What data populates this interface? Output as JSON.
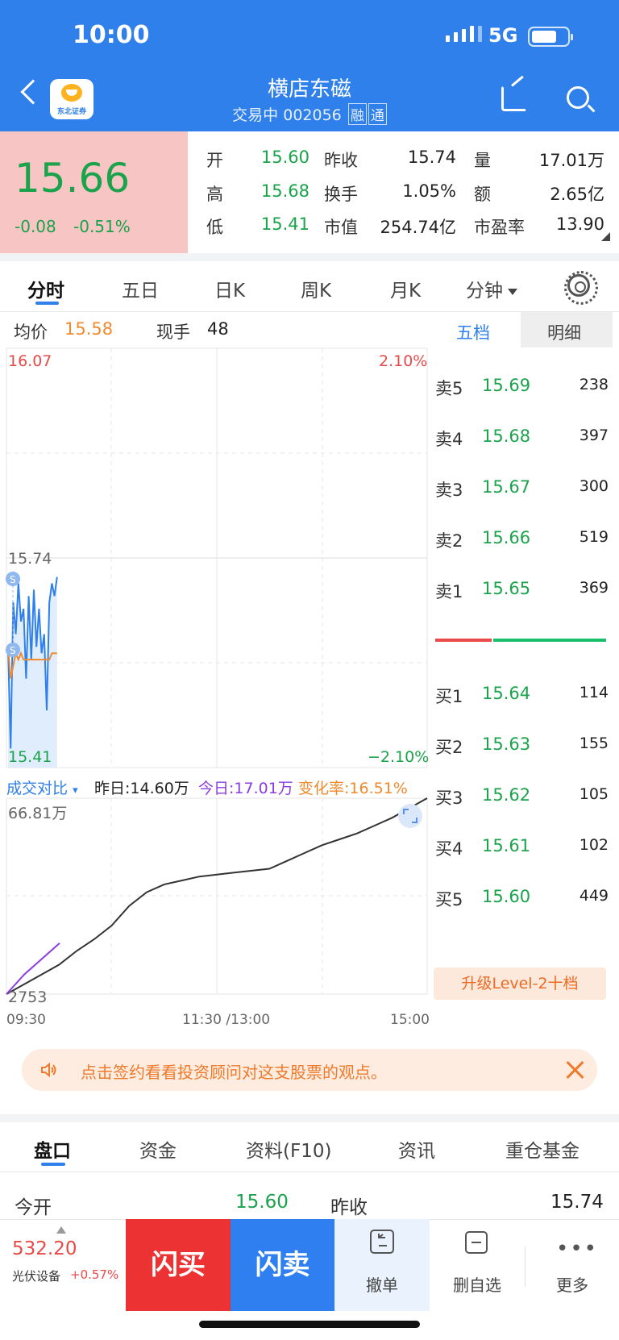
{
  "status_bar": {
    "time": "10:00",
    "network": "5G"
  },
  "header": {
    "broker": "东北证券",
    "stock_name": "横店东磁",
    "status": "交易中",
    "code": "002056",
    "tags": [
      "融",
      "通"
    ]
  },
  "quote": {
    "price": "15.66",
    "change": "-0.08",
    "change_pct": "-0.51%",
    "fields": [
      {
        "label": "开",
        "value": "15.60"
      },
      {
        "label": "昨收",
        "value": "15.74"
      },
      {
        "label": "量",
        "value": "17.01万"
      },
      {
        "label": "高",
        "value": "15.68"
      },
      {
        "label": "换手",
        "value": "1.05%"
      },
      {
        "label": "额",
        "value": "2.65亿"
      },
      {
        "label": "低",
        "value": "15.41"
      },
      {
        "label": "市值",
        "value": "254.74亿"
      },
      {
        "label": "市盈率",
        "value": "13.90"
      }
    ]
  },
  "chart_tabs": [
    "分时",
    "五日",
    "日K",
    "周K",
    "月K",
    "分钟"
  ],
  "chart_header": {
    "avg_label": "均价",
    "avg_value": "15.58",
    "cur_label": "现手",
    "cur_value": "48"
  },
  "orderbook_tabs": [
    "五档",
    "明细"
  ],
  "orderbook": {
    "sell": [
      {
        "label": "卖5",
        "price": "15.69",
        "vol": "238"
      },
      {
        "label": "卖4",
        "price": "15.68",
        "vol": "397"
      },
      {
        "label": "卖3",
        "price": "15.67",
        "vol": "300"
      },
      {
        "label": "卖2",
        "price": "15.66",
        "vol": "519"
      },
      {
        "label": "卖1",
        "price": "15.65",
        "vol": "369"
      }
    ],
    "buy": [
      {
        "label": "买1",
        "price": "15.64",
        "vol": "114"
      },
      {
        "label": "买2",
        "price": "15.63",
        "vol": "155"
      },
      {
        "label": "买3",
        "price": "15.62",
        "vol": "105"
      },
      {
        "label": "买4",
        "price": "15.61",
        "vol": "102"
      },
      {
        "label": "买5",
        "price": "15.60",
        "vol": "449"
      }
    ],
    "upgrade": "升级Level-2十档"
  },
  "chart_data": [
    {
      "type": "line",
      "y_top_label": "16.07",
      "y_mid_label": "15.74",
      "y_bottom_label": "15.41",
      "pct_top_label": "2.10%",
      "pct_bottom_label": "−2.10%",
      "ylim": [
        15.41,
        16.07
      ],
      "series": [
        {
          "values": [
            15.6,
            15.44,
            15.67,
            15.62,
            15.7,
            15.64,
            15.66,
            15.55,
            15.68,
            15.58,
            15.69,
            15.6,
            15.66,
            15.59,
            15.62,
            15.5,
            15.67,
            15.7,
            15.68,
            15.71
          ]
        },
        {
          "values": [
            15.6,
            15.55,
            15.57,
            15.59,
            15.58,
            15.59,
            15.58,
            15.58,
            15.58,
            15.58,
            15.58,
            15.58,
            15.58,
            15.58,
            15.58,
            15.58,
            15.58,
            15.59,
            15.59,
            15.59
          ]
        }
      ],
      "x_ticks": [
        "09:30",
        "11:30 /13:00",
        "15:00"
      ]
    },
    {
      "type": "line",
      "title": "成交对比",
      "yesterday": "昨日:14.60万",
      "today": "今日:17.01万",
      "change_rate": "变化率:16.51%",
      "y_top_label": "66.81万",
      "y_bottom_label": "2753",
      "series": [
        {
          "values": [
            0.0,
            0.05,
            0.1,
            0.15,
            0.22,
            0.28,
            0.35,
            0.45,
            0.52,
            0.56,
            0.58,
            0.6,
            0.61,
            0.62,
            0.63,
            0.64,
            0.68,
            0.72,
            0.76,
            0.79,
            0.82,
            0.86,
            0.9,
            0.95,
            1.0
          ]
        },
        {
          "values": [
            0.0,
            0.1,
            0.18,
            0.26
          ]
        }
      ]
    }
  ],
  "notice": "点击签约看看投资顾问对这支股票的观点。",
  "bottom_tabs": [
    "盘口",
    "资金",
    "资料(F10)",
    "资讯",
    "重仓基金"
  ],
  "open_row": {
    "open_label": "今开",
    "open_value": "15.60",
    "prev_label": "昨收",
    "prev_value": "15.74"
  },
  "bottom_bar": {
    "index_value": "532.20",
    "index_name": "光伏设备",
    "index_change": "+0.57%",
    "buy": "闪买",
    "sell": "闪卖",
    "cancel": "撤单",
    "remove_watch": "删自选",
    "more": "更多"
  },
  "colors": {
    "up": "#e84a4a",
    "down": "#1aa34a",
    "brand": "#2f80ea",
    "avg_line": "#f08a2c",
    "volume_today": "#8a3ce0"
  }
}
